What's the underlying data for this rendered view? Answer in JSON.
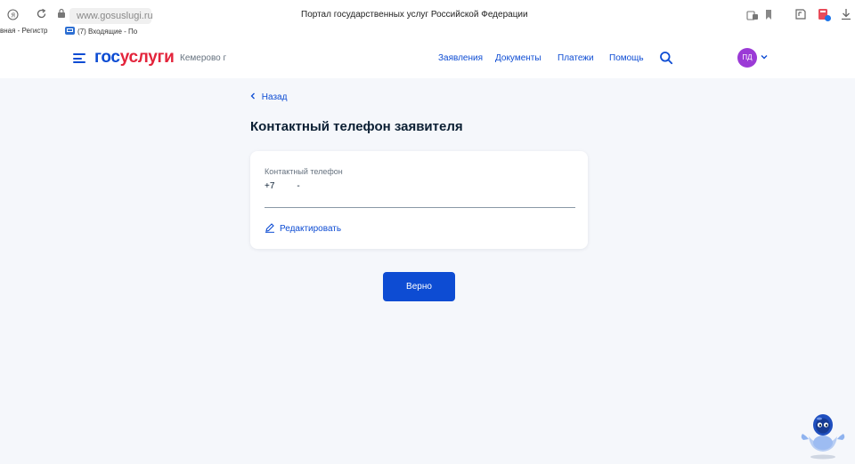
{
  "browser": {
    "url": "www.gosuslugi.ru",
    "window_title": "Портал государственных услуг Российской Федерации",
    "bookmarks": [
      "вная - Регистр",
      "(7) Входящие - По"
    ]
  },
  "header": {
    "logo_part1": "гос",
    "logo_part2": "услуги",
    "city": "Кемерово г",
    "nav": [
      "Заявления",
      "Документы",
      "Платежи",
      "Помощь"
    ],
    "avatar_initials": "ПД"
  },
  "main": {
    "back_label": "Назад",
    "title": "Контактный телефон заявителя",
    "card": {
      "field_label": "Контактный телефон",
      "field_value": "+7         -",
      "edit_label": "Редактировать"
    },
    "confirm_label": "Верно"
  },
  "colors": {
    "accent": "#0d4cd3",
    "logo_red": "#e3243b",
    "avatar": "#9b3ad6",
    "page_bg": "#f5f7fb"
  }
}
